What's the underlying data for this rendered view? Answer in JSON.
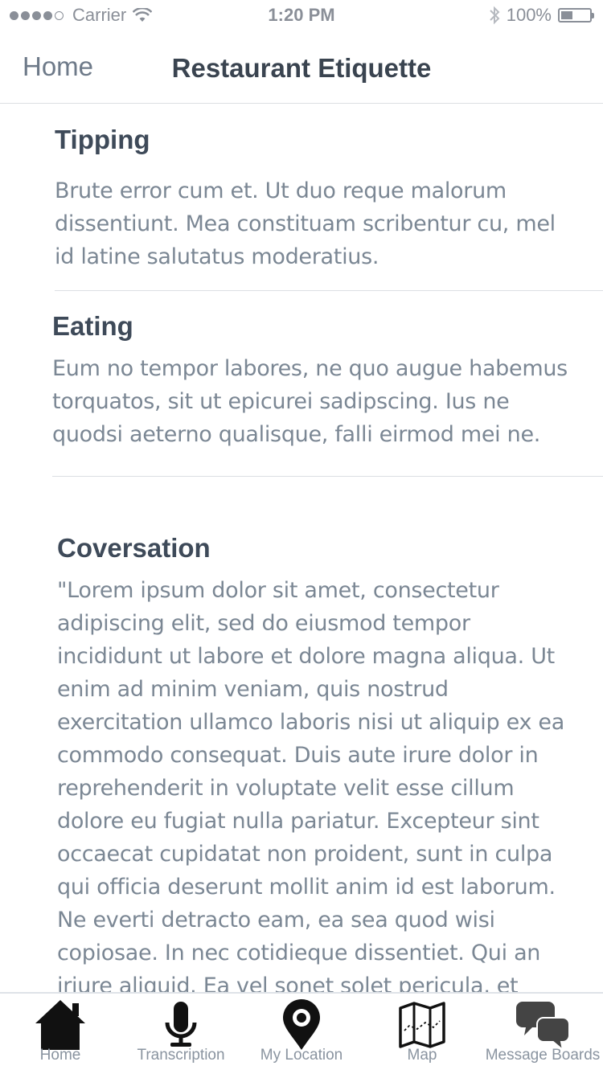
{
  "status_bar": {
    "carrier": "Carrier",
    "time": "1:20 PM",
    "battery": "100%",
    "signal_bars_filled": 4,
    "signal_bars_total": 5
  },
  "nav": {
    "back_label": "Home",
    "title": "Restaurant Etiquette"
  },
  "sections": [
    {
      "heading": "Tipping",
      "body": "Brute error cum et. Ut duo reque malorum dissentiunt. Mea constituam scribentur cu, mel id latine salutatus moderatius."
    },
    {
      "heading": "Eating",
      "body": "Eum no tempor labores, ne quo augue habemus torquatos, sit ut epicurei sadipscing. Ius ne quodsi aeterno qualisque, falli eirmod mei ne."
    },
    {
      "heading": "Coversation",
      "body": "\"Lorem ipsum dolor sit amet, consectetur adipiscing elit, sed do eiusmod tempor incididunt ut labore et dolore magna aliqua. Ut enim ad minim veniam, quis nostrud exercitation ullamco laboris nisi ut aliquip ex ea commodo consequat. Duis aute irure dolor in reprehenderit in voluptate velit esse cillum dolore eu fugiat nulla pariatur. Excepteur sint occaecat cupidatat non proident, sunt in culpa qui officia deserunt mollit anim id est laborum. Ne everti detracto eam, ea sea quod wisi copiosae. In nec cotidieque dissentiet. Qui an iriure aliquid. Ea vel sonet solet pericula, et"
    }
  ],
  "tabs": [
    {
      "label": "Home",
      "icon": "home-icon"
    },
    {
      "label": "Transcription",
      "icon": "microphone-icon"
    },
    {
      "label": "My Location",
      "icon": "location-pin-icon"
    },
    {
      "label": "Map",
      "icon": "map-icon"
    },
    {
      "label": "Message Boards",
      "icon": "chat-bubbles-icon"
    }
  ],
  "colors": {
    "heading": "#3e4a59",
    "body_text": "#7b8794",
    "divider": "#dcdfe3",
    "tab_label": "#8a94a0",
    "active_icon": "#111111"
  }
}
